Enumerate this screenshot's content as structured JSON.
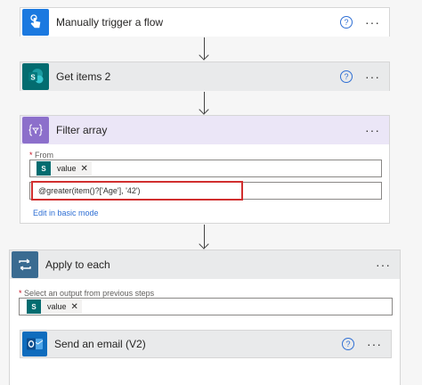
{
  "steps": {
    "trigger": {
      "title": "Manually trigger a flow",
      "help": "?",
      "more": "···"
    },
    "get_items": {
      "title": "Get items 2",
      "help": "?",
      "more": "···"
    },
    "filter": {
      "title": "Filter array",
      "more": "···",
      "from_label": "From",
      "required_mark": "*",
      "token_value": "value",
      "token_remove": "✕",
      "expression": "@greater(item()?['Age'], '42')",
      "edit_link": "Edit in basic mode"
    },
    "apply": {
      "title": "Apply to each",
      "more": "···",
      "select_label": "Select an output from previous steps",
      "required_mark": "*",
      "token_value": "value",
      "token_remove": "✕"
    },
    "email": {
      "title": "Send an email (V2)",
      "help": "?",
      "more": "···"
    }
  },
  "colors": {
    "trigger_icon": "#1b79e0",
    "sharepoint": "#036c70",
    "filter_icon": "#8c6fcb",
    "filter_header": "#ebe6f7",
    "apply_icon": "#3a6b91",
    "outlook": "#0f6cbd",
    "highlight": "#d12f2f"
  },
  "icons": {
    "trigger": "touch-hand-icon",
    "get_items": "sharepoint-icon",
    "filter": "filter-curly-braces-icon",
    "apply": "loop-icon",
    "email": "outlook-icon"
  }
}
